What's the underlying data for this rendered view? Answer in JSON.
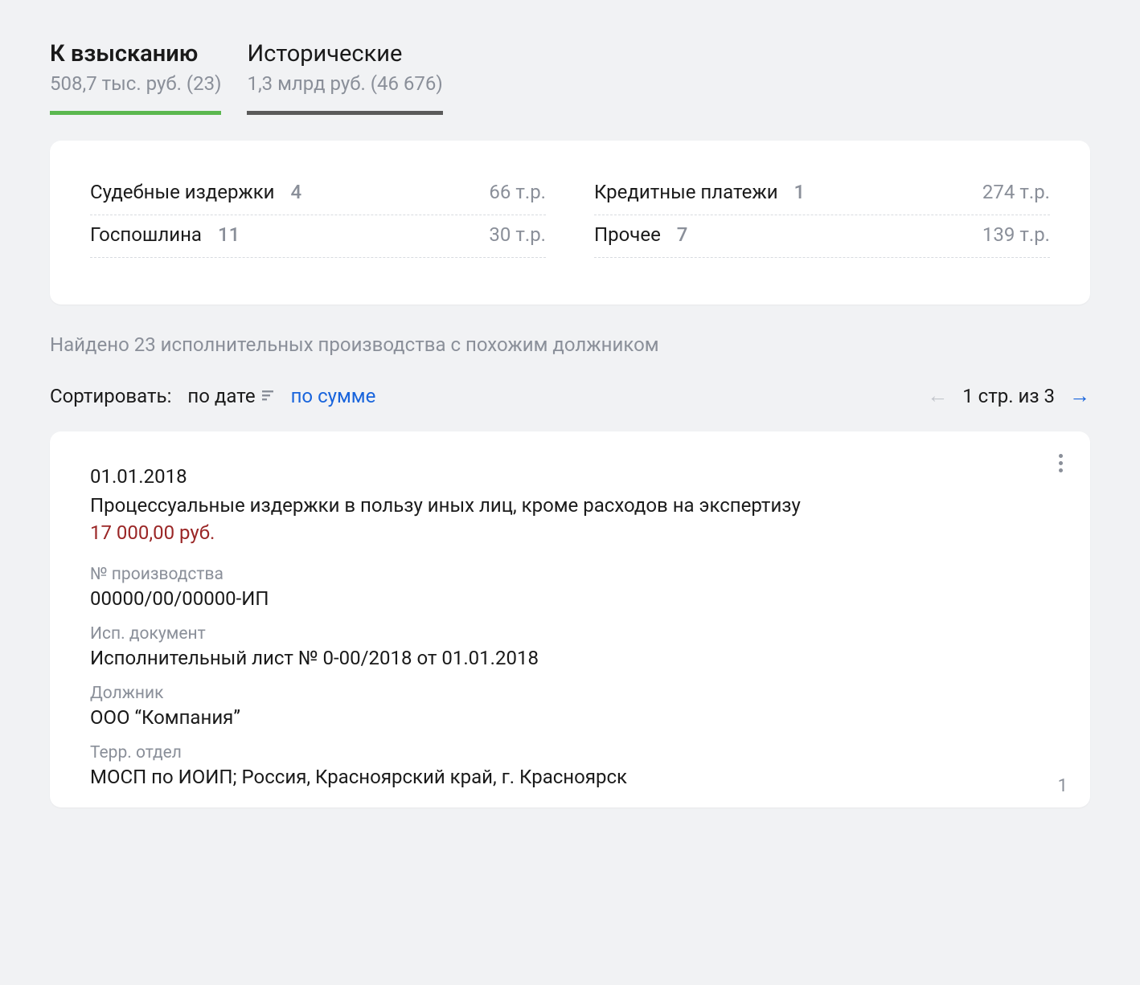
{
  "tabs": [
    {
      "title": "К взысканию",
      "subtitle": "508,7 тыс. руб. (23)",
      "active": true
    },
    {
      "title": "Исторические",
      "subtitle": "1,3 млрд руб. (46 676)",
      "active": false
    }
  ],
  "summary": {
    "left": [
      {
        "label": "Судебные издержки",
        "count": "4",
        "amount": "66 т.р."
      },
      {
        "label": "Госпошлина",
        "count": "11",
        "amount": "30 т.р."
      }
    ],
    "right": [
      {
        "label": "Кредитные платежи",
        "count": "1",
        "amount": "274 т.р."
      },
      {
        "label": "Прочее",
        "count": "7",
        "amount": "139 т.р."
      }
    ]
  },
  "found_text": "Найдено 23 исполнительных производства с похожим должником",
  "sort": {
    "label": "Сортировать:",
    "by_date": "по дате",
    "by_sum": "по сумме"
  },
  "pager": {
    "text": "1 стр. из 3"
  },
  "record": {
    "date": "01.01.2018",
    "title": "Процессуальные издержки в пользу иных лиц, кроме расходов на экспертизу",
    "amount": "17 000,00 руб.",
    "case_no_label": "№ производства",
    "case_no": "00000/00/00000-ИП",
    "doc_label": "Исп. документ",
    "doc": "Исполнительный лист № 0-00/2018 от 01.01.2018",
    "debtor_label": "Должник",
    "debtor": "ООО “Компания”",
    "dept_label": "Терр. отдел",
    "dept": "МОСП по ИОИП; Россия, Красноярский край, г. Красноярск",
    "index": "1"
  }
}
